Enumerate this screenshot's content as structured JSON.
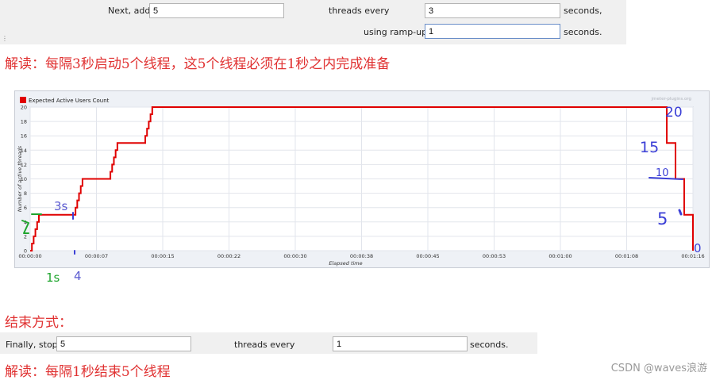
{
  "ramp_panel": {
    "next_add_label": "Next, add",
    "next_add_value": "5",
    "threads_every_label": "threads every",
    "threads_every_value": "3",
    "seconds_label_1": "seconds,",
    "ramp_up_label": "using ramp-up",
    "ramp_up_value": "1",
    "seconds_label_2": "seconds."
  },
  "note_start": "解读：每隔3秒启动5个线程，这5个线程必须在1秒之内完成准备",
  "chart_data": {
    "type": "line",
    "legend": [
      "Expected Active Users Count"
    ],
    "legend_position": "top-left",
    "watermark": "jmeter-plugins.org",
    "xlabel": "Elapsed time",
    "ylabel": "Number of active threads",
    "x_ticks": [
      "00:00:00",
      "00:00:07",
      "00:00:15",
      "00:00:22",
      "00:00:30",
      "00:00:38",
      "00:00:45",
      "00:00:53",
      "00:01:00",
      "00:01:08",
      "00:01:16"
    ],
    "y_ticks": [
      0,
      2,
      4,
      6,
      8,
      10,
      12,
      14,
      16,
      18,
      20
    ],
    "ylim": [
      0,
      20
    ],
    "xlim_seconds": [
      0,
      76
    ],
    "grid": true,
    "series": [
      {
        "name": "Expected Active Users Count",
        "color": "#e00000",
        "points_seconds": [
          [
            0,
            0
          ],
          [
            0.2,
            1
          ],
          [
            0.4,
            2
          ],
          [
            0.6,
            3
          ],
          [
            0.8,
            4
          ],
          [
            1,
            5
          ],
          [
            5,
            5
          ],
          [
            5.2,
            6
          ],
          [
            5.4,
            7
          ],
          [
            5.6,
            8
          ],
          [
            5.8,
            9
          ],
          [
            6,
            10
          ],
          [
            9,
            10
          ],
          [
            9.2,
            11
          ],
          [
            9.4,
            12
          ],
          [
            9.6,
            13
          ],
          [
            9.8,
            14
          ],
          [
            10,
            15
          ],
          [
            13,
            15
          ],
          [
            13.2,
            16
          ],
          [
            13.4,
            17
          ],
          [
            13.6,
            18
          ],
          [
            13.8,
            19
          ],
          [
            14,
            20
          ],
          [
            73,
            20
          ],
          [
            73,
            15
          ],
          [
            74,
            15
          ],
          [
            74,
            10
          ],
          [
            75,
            10
          ],
          [
            75,
            5
          ],
          [
            76,
            5
          ],
          [
            76,
            0
          ]
        ]
      }
    ]
  },
  "annotations": {
    "hand_3s": "3s",
    "hand_1s": "1s",
    "hand_4": "4",
    "hand_5_left": "5",
    "hand_20": "20",
    "hand_15": "15",
    "hand_10": "10",
    "hand_5_right": "5",
    "hand_0": "0"
  },
  "end_title": "结束方式：",
  "stop_panel": {
    "finally_stop_label": "Finally, stop",
    "finally_stop_value": "5",
    "threads_every_label": "threads every",
    "threads_every_value": "1",
    "seconds_label": "seconds."
  },
  "note_end": "解读：每隔1秒结束5个线程",
  "watermark_text": "CSDN @waves浪游"
}
